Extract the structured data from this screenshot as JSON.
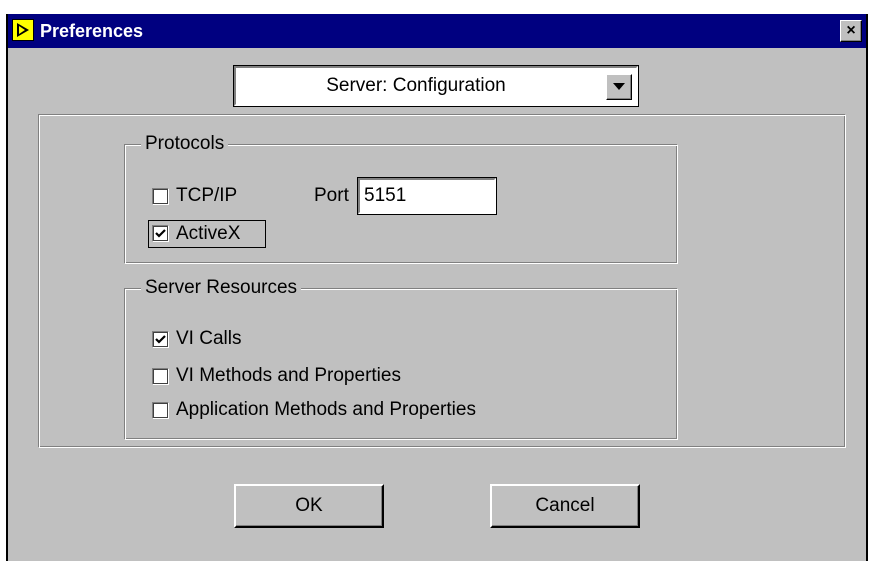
{
  "window": {
    "title": "Preferences",
    "close_symbol": "×"
  },
  "category_dropdown": {
    "selected": "Server: Configuration"
  },
  "protocols": {
    "legend": "Protocols",
    "tcpip": {
      "label": "TCP/IP",
      "checked": false
    },
    "port": {
      "label": "Port",
      "value": "5151"
    },
    "activex": {
      "label": "ActiveX",
      "checked": true
    }
  },
  "server_resources": {
    "legend": "Server Resources",
    "items": [
      {
        "label": "VI Calls",
        "checked": true
      },
      {
        "label": "VI Methods and Properties",
        "checked": false
      },
      {
        "label": "Application Methods and Properties",
        "checked": false
      }
    ]
  },
  "buttons": {
    "ok": "OK",
    "cancel": "Cancel"
  },
  "icons": {
    "app": "labview-icon",
    "close": "close-icon",
    "dropdown": "chevron-down-icon",
    "check": "checkmark-icon"
  },
  "colors": {
    "titlebar": "#000080",
    "face": "#c0c0c0"
  }
}
